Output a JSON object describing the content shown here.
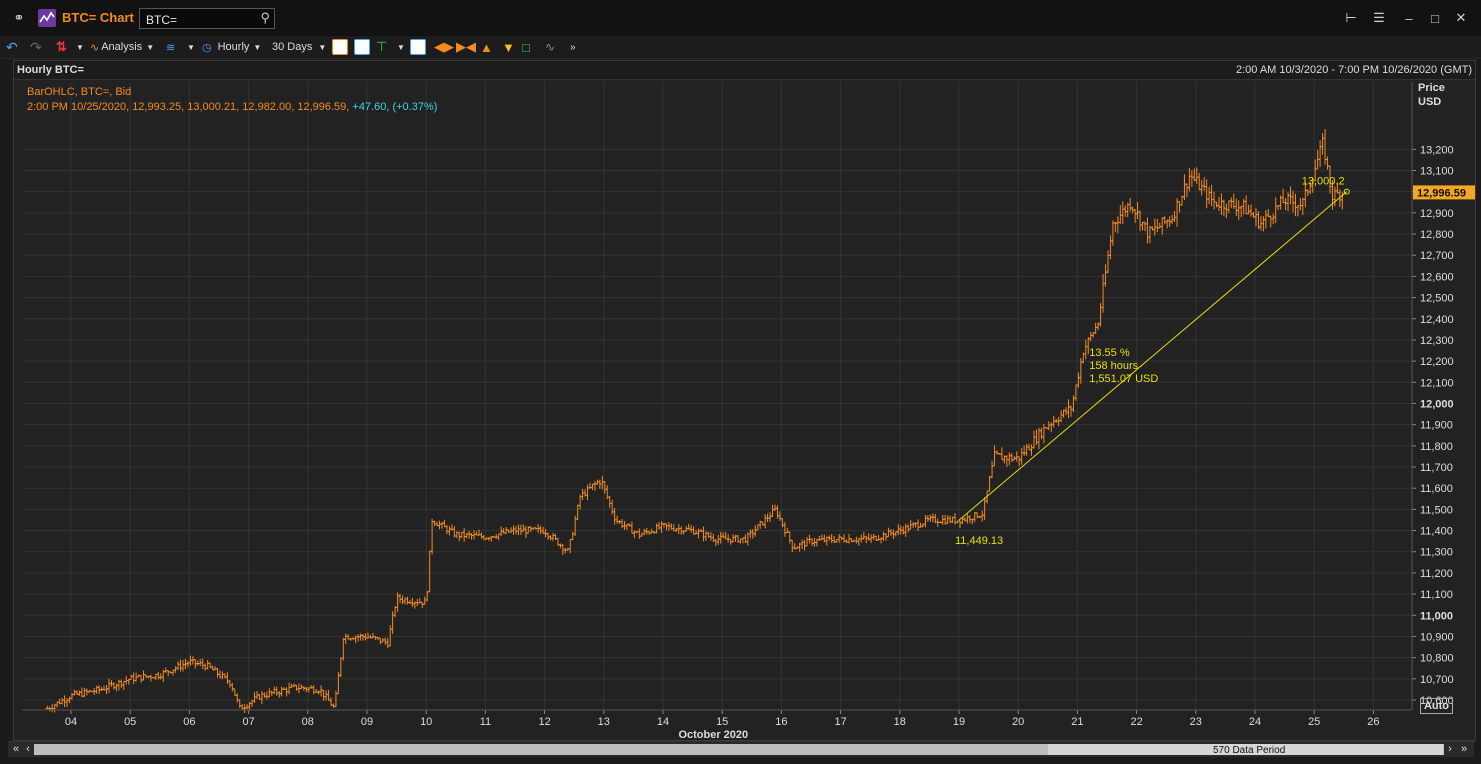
{
  "window": {
    "title": "BTC= Chart",
    "search_value": "BTC="
  },
  "toolbar": {
    "analysis_label": "Analysis",
    "interval_label": "Hourly",
    "range_label": "30 Days"
  },
  "chart_header": {
    "left": "Hourly BTC=",
    "right": "2:00 AM 10/3/2020 - 7:00 PM 10/26/2020 (GMT)"
  },
  "legend": {
    "line1": "BarOHLC, BTC=, Bid",
    "values": "2:00 PM 10/25/2020, 12,993.25, 13,000.21, 12,982.00, 12,996.59,",
    "change": "+47.60, (+0.37%)"
  },
  "axis": {
    "price_title": "Price",
    "currency": "USD",
    "x_title": "October 2020",
    "last_price": "12,996.59",
    "auto_label": "Auto"
  },
  "scroll": {
    "label": "570 Data Period"
  },
  "colors": {
    "bars": "#f28b20",
    "trend": "#e8e000",
    "change": "#39d6e0",
    "last_badge": "#f5a623"
  },
  "annotations": {
    "trend_pct": "13.55 %",
    "trend_hours": "158 hours",
    "trend_usd": "1,551.07 USD",
    "start_label": "11,449.13",
    "end_label": "13,000.2"
  },
  "chart_data": {
    "type": "ohlc",
    "x_axis": "date (day of October 2020)",
    "ticks_x": [
      "04",
      "05",
      "06",
      "07",
      "08",
      "09",
      "10",
      "11",
      "12",
      "13",
      "14",
      "15",
      "16",
      "17",
      "18",
      "19",
      "20",
      "21",
      "22",
      "23",
      "24",
      "25",
      "26"
    ],
    "ylim": [
      10500,
      13400
    ],
    "y_ticks": [
      10600,
      10700,
      10800,
      10900,
      11000,
      11100,
      11200,
      11300,
      11400,
      11500,
      11600,
      11700,
      11800,
      11900,
      12000,
      12100,
      12200,
      12300,
      12400,
      12500,
      12600,
      12700,
      12800,
      12900,
      13000,
      13100,
      13200
    ],
    "y_tick_labels": [
      "10,600",
      "10,700",
      "10,800",
      "10,900",
      "11,000",
      "11,100",
      "11,200",
      "11,300",
      "11,400",
      "11,500",
      "11,600",
      "11,700",
      "11,800",
      "11,900",
      "12,000",
      "12,100",
      "12,200",
      "12,300",
      "12,400",
      "12,500",
      "12,600",
      "12,700",
      "12,800",
      "12,900",
      "13,000",
      "13,100",
      "13,200"
    ],
    "y_bold_ticks": [
      11000,
      12000,
      13000
    ],
    "series_keypoints": [
      {
        "day": 3.6,
        "price": 10560
      },
      {
        "day": 4.0,
        "price": 10620
      },
      {
        "day": 4.5,
        "price": 10650
      },
      {
        "day": 5.0,
        "price": 10700
      },
      {
        "day": 5.5,
        "price": 10720
      },
      {
        "day": 6.0,
        "price": 10780
      },
      {
        "day": 6.3,
        "price": 10760
      },
      {
        "day": 6.7,
        "price": 10680
      },
      {
        "day": 6.85,
        "price": 10560
      },
      {
        "day": 7.2,
        "price": 10620
      },
      {
        "day": 7.8,
        "price": 10660
      },
      {
        "day": 8.2,
        "price": 10650
      },
      {
        "day": 8.45,
        "price": 10560
      },
      {
        "day": 8.6,
        "price": 10900
      },
      {
        "day": 9.0,
        "price": 10900
      },
      {
        "day": 9.35,
        "price": 10870
      },
      {
        "day": 9.5,
        "price": 11080
      },
      {
        "day": 10.0,
        "price": 11060
      },
      {
        "day": 10.1,
        "price": 11450
      },
      {
        "day": 10.5,
        "price": 11380
      },
      {
        "day": 11.0,
        "price": 11370
      },
      {
        "day": 11.5,
        "price": 11400
      },
      {
        "day": 12.0,
        "price": 11400
      },
      {
        "day": 12.4,
        "price": 11300
      },
      {
        "day": 12.6,
        "price": 11560
      },
      {
        "day": 12.95,
        "price": 11640
      },
      {
        "day": 13.2,
        "price": 11450
      },
      {
        "day": 13.6,
        "price": 11380
      },
      {
        "day": 14.0,
        "price": 11420
      },
      {
        "day": 14.5,
        "price": 11400
      },
      {
        "day": 14.9,
        "price": 11360
      },
      {
        "day": 15.4,
        "price": 11360
      },
      {
        "day": 15.9,
        "price": 11500
      },
      {
        "day": 16.2,
        "price": 11320
      },
      {
        "day": 16.5,
        "price": 11350
      },
      {
        "day": 17.0,
        "price": 11360
      },
      {
        "day": 17.5,
        "price": 11360
      },
      {
        "day": 18.0,
        "price": 11400
      },
      {
        "day": 18.5,
        "price": 11450
      },
      {
        "day": 19.0,
        "price": 11449
      },
      {
        "day": 19.4,
        "price": 11480
      },
      {
        "day": 19.6,
        "price": 11750
      },
      {
        "day": 20.0,
        "price": 11740
      },
      {
        "day": 20.5,
        "price": 11900
      },
      {
        "day": 20.9,
        "price": 11980
      },
      {
        "day": 21.1,
        "price": 12250
      },
      {
        "day": 21.35,
        "price": 12380
      },
      {
        "day": 21.6,
        "price": 12850
      },
      {
        "day": 21.9,
        "price": 12950
      },
      {
        "day": 22.2,
        "price": 12800
      },
      {
        "day": 22.6,
        "price": 12880
      },
      {
        "day": 22.9,
        "price": 13080
      },
      {
        "day": 23.3,
        "price": 12950
      },
      {
        "day": 23.8,
        "price": 12930
      },
      {
        "day": 24.1,
        "price": 12850
      },
      {
        "day": 24.5,
        "price": 12960
      },
      {
        "day": 24.8,
        "price": 12940
      },
      {
        "day": 25.0,
        "price": 13100
      },
      {
        "day": 25.15,
        "price": 13230
      },
      {
        "day": 25.3,
        "price": 12980
      },
      {
        "day": 25.5,
        "price": 12997
      }
    ],
    "trendline": {
      "start_day": 19.0,
      "start_price": 11449.13,
      "end_day": 25.55,
      "end_price": 13000.2
    }
  }
}
